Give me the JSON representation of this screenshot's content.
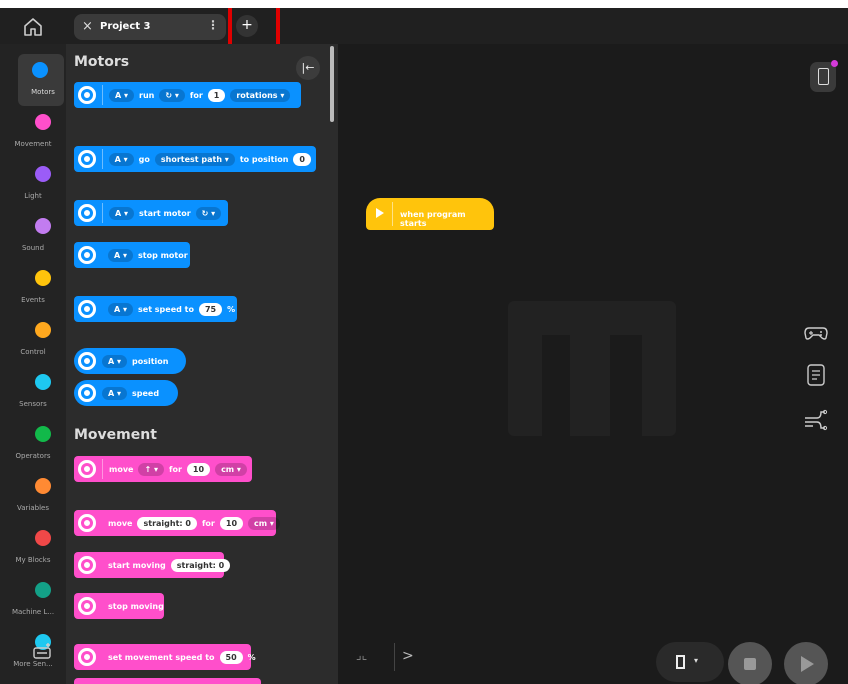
{
  "tab": {
    "title": "Project 3",
    "close_icon": "×",
    "menu_icon": "⋮",
    "add_label": "+"
  },
  "categories": [
    {
      "name": "Motors",
      "color": "#0a91ff"
    },
    {
      "name": "Movement",
      "color": "#ff4fcb"
    },
    {
      "name": "Light",
      "color": "#9b5cf7"
    },
    {
      "name": "Sound",
      "color": "#c27cf0"
    },
    {
      "name": "Events",
      "color": "#ffc40c"
    },
    {
      "name": "Control",
      "color": "#ffa81e"
    },
    {
      "name": "Sensors",
      "color": "#1ec8f0"
    },
    {
      "name": "Operators",
      "color": "#12b94a"
    },
    {
      "name": "Variables",
      "color": "#ff8a33"
    },
    {
      "name": "My Blocks",
      "color": "#f04848"
    },
    {
      "name": "Machine L...",
      "color": "#13a087"
    },
    {
      "name": "More Sen...",
      "color": "#1ec8f0"
    }
  ],
  "palette": {
    "collapse_icon": "|←",
    "motors_heading": "Motors",
    "movement_heading": "Movement",
    "motors": {
      "run": {
        "port": "A ▾",
        "label": "run",
        "dir": "↻ ▾",
        "for": "for",
        "value": "1",
        "unit": "rotations ▾"
      },
      "go": {
        "port": "A ▾",
        "label": "go",
        "mode": "shortest path ▾",
        "to": "to position",
        "value": "0"
      },
      "start": {
        "port": "A ▾",
        "label": "start motor",
        "dir": "↻ ▾"
      },
      "stop": {
        "port": "A ▾",
        "label": "stop motor"
      },
      "speed": {
        "port": "A ▾",
        "label": "set speed to",
        "value": "75",
        "unit": "%"
      },
      "position": {
        "port": "A ▾",
        "label": "position"
      },
      "speed_reporter": {
        "port": "A ▾",
        "label": "speed"
      }
    },
    "movement": {
      "move1": {
        "label": "move",
        "dir": "↑ ▾",
        "for": "for",
        "value": "10",
        "unit": "cm ▾"
      },
      "move2": {
        "label": "move",
        "steer": "straight: 0",
        "for": "for",
        "value": "10",
        "unit": "cm ▾"
      },
      "start_moving": {
        "label": "start moving",
        "steer": "straight: 0"
      },
      "stop_moving": {
        "label": "stop moving"
      },
      "set_speed": {
        "label": "set movement speed to",
        "value": "50",
        "unit": "%"
      }
    }
  },
  "canvas": {
    "hat_label": "when program starts",
    "zoom_icon": "⌟⌞",
    "expand_icon": ">",
    "slot_dropdown": "▾"
  }
}
